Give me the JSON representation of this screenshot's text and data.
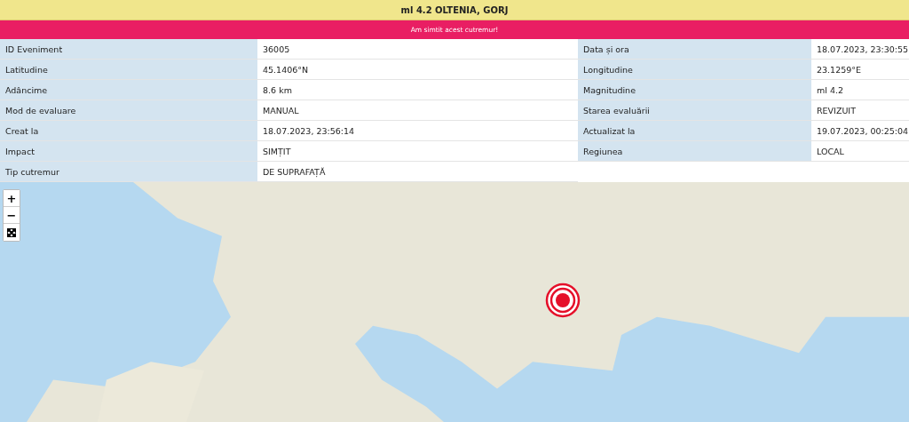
{
  "title": "ml 4.2 OLTENIA, GORJ",
  "felt_button": "Am simtit acest cutremur!",
  "details": [
    {
      "label": "ID Eveniment",
      "value": "36005"
    },
    {
      "label": "Data și ora",
      "value": "18.07.2023, 23:30:55"
    },
    {
      "label": "Latitudine",
      "value": "45.1406°N"
    },
    {
      "label": "Longitudine",
      "value": "23.1259°E"
    },
    {
      "label": "Adâncime",
      "value": "8.6 km"
    },
    {
      "label": "Magnitudine",
      "value": "ml 4.2"
    },
    {
      "label": "Mod de evaluare",
      "value": "MANUAL"
    },
    {
      "label": "Starea evaluării",
      "value": "REVIZUIT"
    },
    {
      "label": "Creat la",
      "value": "18.07.2023, 23:56:14"
    },
    {
      "label": "Actualizat la",
      "value": "19.07.2023, 00:25:04"
    },
    {
      "label": "Impact",
      "value": "SIMȚIT"
    },
    {
      "label": "Regiunea",
      "value": "LOCAL"
    },
    {
      "label": "Tip cutremur",
      "value": "DE SUPRAFAȚĂ"
    }
  ],
  "map": {
    "zoom_in": "+",
    "zoom_out": "−"
  }
}
